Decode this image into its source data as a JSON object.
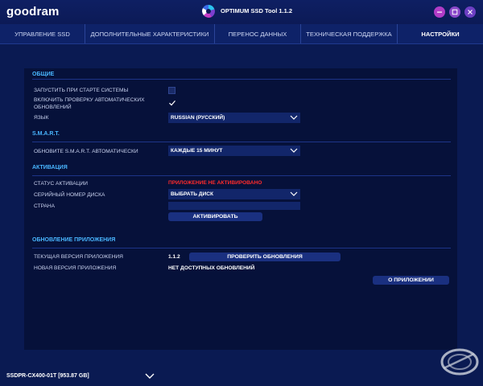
{
  "brand": {
    "logo_text": "goodram"
  },
  "window": {
    "title": "OPTIMUM SSD Tool 1.1.2",
    "buttons": [
      "minimize-icon",
      "maximize-icon",
      "close-icon"
    ],
    "accent_colors": {
      "minimize": "#b13cc7",
      "maximize": "#8a48c9",
      "close": "#6d3fc3"
    }
  },
  "nav": {
    "tabs": [
      {
        "label": "УПРАВЛЕНИЕ SSD",
        "active": false
      },
      {
        "label": "ДОПОЛНИТЕЛЬНЫЕ ХАРАКТЕРИСТИКИ",
        "active": false
      },
      {
        "label": "ПЕРЕНОС ДАННЫХ",
        "active": false
      },
      {
        "label": "ТЕХНИЧЕСКАЯ ПОДДЕРЖКА",
        "active": false
      },
      {
        "label": "НАСТРОЙКИ",
        "active": true
      }
    ]
  },
  "settings": {
    "general": {
      "heading": "ОБЩИЕ",
      "autostart_label": "ЗАПУСТИТЬ ПРИ СТАРТЕ СИСТЕМЫ",
      "autostart_checked": false,
      "autoupdate_label": "ВКЛЮЧИТЬ ПРОВЕРКУ АВТОМАТИЧЕСКИХ ОБНОВЛЕНИЙ",
      "autoupdate_checked": true,
      "language_label": "ЯЗЫК",
      "language_value": "RUSSIAN (РУССКИЙ)"
    },
    "smart": {
      "heading": "S.M.A.R.T.",
      "update_label": "ОБНОВИТЕ S.M.A.R.T. АВТОМАТИЧЕСКИ",
      "update_value": "КАЖДЫЕ 15 МИНУТ"
    },
    "activation": {
      "heading": "АКТИВАЦИЯ",
      "status_label": "СТАТУС АКТИВАЦИИ",
      "status_value": "ПРИЛОЖЕНИЕ НЕ АКТИВИРОВАНО",
      "status_color": "#ff2b2b",
      "serial_label": "СЕРИЙНЫЙ НОМЕР ДИСКА",
      "serial_value": "ВЫБРАТЬ ДИСК",
      "country_label": "СТРАНА",
      "country_value": "",
      "activate_button": "АКТИВИРОВАТЬ"
    },
    "app_update": {
      "heading": "ОБНОВЛЕНИЕ ПРИЛОЖЕНИЯ",
      "current_label": "ТЕКУЩАЯ ВЕРСИЯ ПРИЛОЖЕНИЯ",
      "current_value": "1.1.2",
      "check_button": "ПРОВЕРИТЬ ОБНОВЛЕНИЯ",
      "new_label": "НОВАЯ ВЕРСИЯ ПРИЛОЖЕНИЯ",
      "new_value": "НЕТ ДОСТУПНЫХ ОБНОВЛЕНИЙ",
      "about_button": "О ПРИЛОЖЕНИИ"
    }
  },
  "status_bar": {
    "drive": "SSDPR-CX400-01T [953.87 GB]",
    "drive_selector_icon": "chevron-down-icon"
  },
  "watermark": {
    "text": "ixbt"
  },
  "colors": {
    "background": "#0a1a52",
    "panel": "#06113a",
    "section_heading": "#49b6ff",
    "control": "#12266a"
  }
}
